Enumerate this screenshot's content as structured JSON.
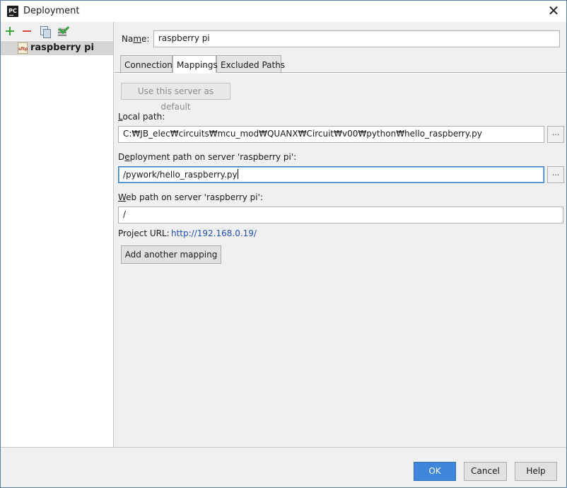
{
  "window": {
    "title": "Deployment",
    "app_icon_text": "PC"
  },
  "servers": [
    {
      "label": "raspberry pi",
      "icon_text": "sftp",
      "selected": true
    }
  ],
  "form": {
    "name_label_pre": "Na",
    "name_label_mnemonic": "m",
    "name_label_post": "e:",
    "name_value": "raspberry pi"
  },
  "tabs": [
    {
      "label": "Connection",
      "active": false
    },
    {
      "label": "Mappings",
      "active": true
    },
    {
      "label": "Excluded Paths",
      "active": false
    }
  ],
  "mappings": {
    "use_default_label": "Use this server as default",
    "local_path_mnemonic": "L",
    "local_path_rest": "ocal path:",
    "local_path_value": "C:₩JB_elec₩circuits₩mcu_mod₩QUANX₩Circuit₩v00₩python₩hello_raspberry.py",
    "deploy_path_pre": "D",
    "deploy_path_mnemonic": "e",
    "deploy_path_rest": "ployment path on server 'raspberry pi':",
    "deploy_path_value": "/pywork/hello_raspberry.py",
    "web_path_mnemonic": "W",
    "web_path_rest": "eb path on server 'raspberry pi':",
    "web_path_value": "/",
    "project_url_label": "Project URL:",
    "project_url_value": "http://192.168.0.19/",
    "browse_label": "...",
    "add_mapping_label": "Add another mapping"
  },
  "buttons": {
    "ok": "OK",
    "cancel": "Cancel",
    "help": "Help"
  },
  "colors": {
    "accent": "#3d86d9",
    "link": "#2251b8",
    "add_green": "#3aa53a",
    "remove_red": "#d6453d"
  },
  "icons": {
    "add": "plus-icon",
    "remove": "minus-icon",
    "copy": "copy-icon",
    "set_default": "check-icon",
    "close": "close-icon",
    "server": "sftp-icon"
  }
}
